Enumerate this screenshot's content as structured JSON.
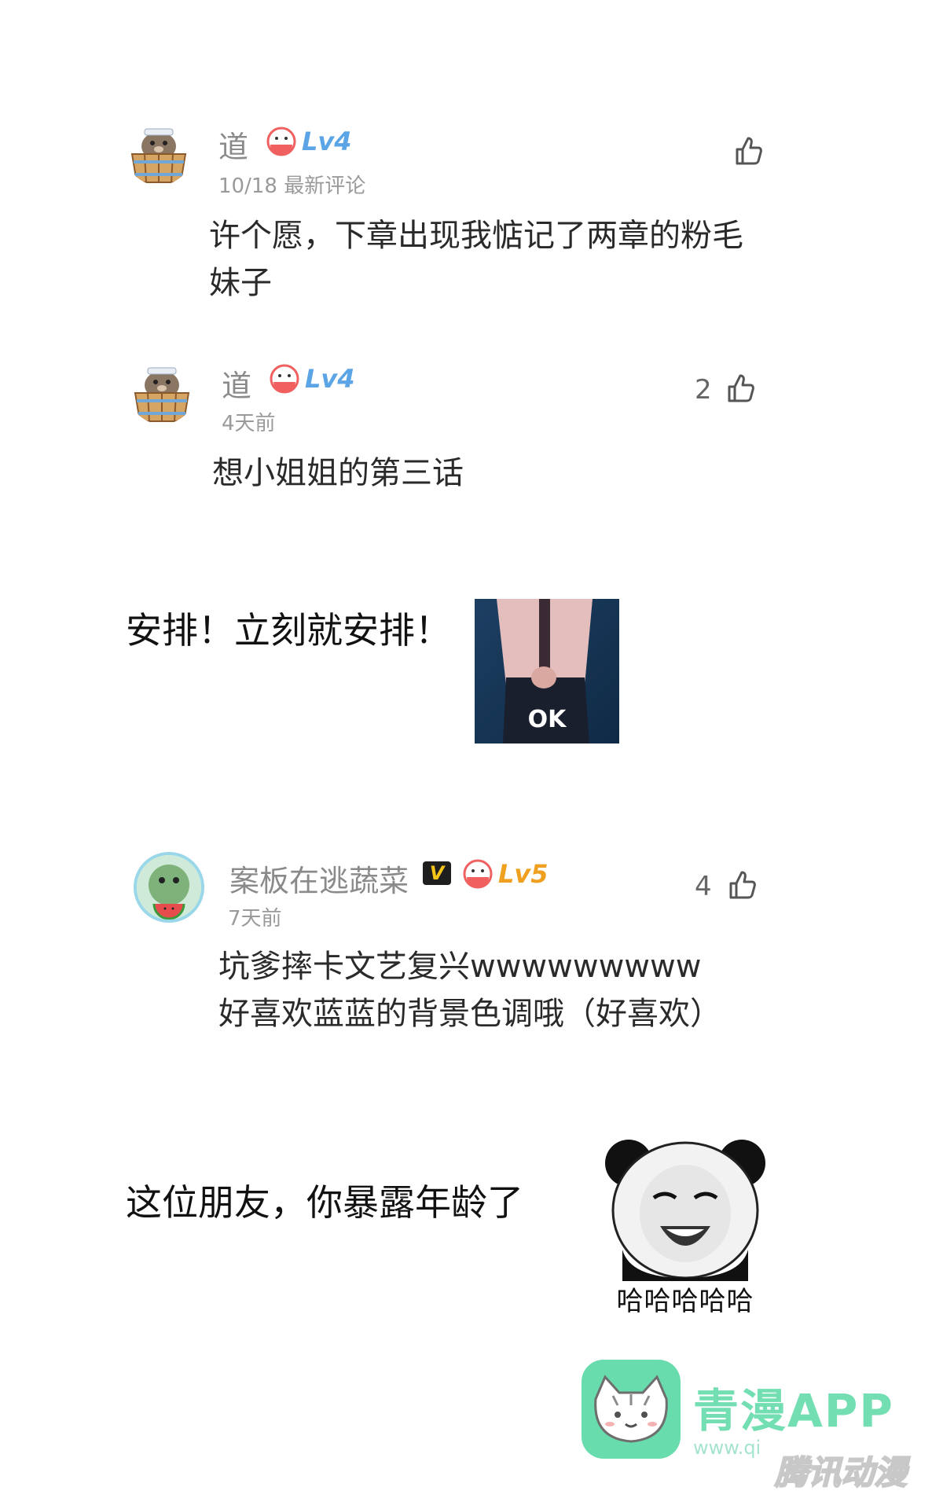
{
  "comments": [
    {
      "username": "道",
      "level": "Lv4",
      "meta": "10/18 最新评论",
      "likes": "",
      "lines": [
        "许个愿，下章出现我惦记了两章的粉毛",
        "妹子"
      ]
    },
    {
      "username": "道",
      "level": "Lv4",
      "meta": "4天前",
      "likes": "2",
      "lines": [
        "想小姐姐的第三话"
      ]
    },
    {
      "username": "案板在逃蔬菜",
      "vip": "V",
      "level": "Lv5",
      "meta": "7天前",
      "likes": "4",
      "lines": [
        "坑爹摔卡文艺复兴wwwwwwwww",
        "好喜欢蓝蓝的背景色调哦（好喜欢）"
      ]
    }
  ],
  "replies": [
    {
      "text": "安排！立刻就安排！",
      "sticker_label": "OK"
    },
    {
      "text": "这位朋友，你暴露年龄了",
      "sticker_label": "哈哈哈哈哈"
    }
  ],
  "watermark": {
    "brand": "青漫APP",
    "url": "www.qi",
    "corner_mark": "腾讯动漫"
  },
  "colors": {
    "level4": "#5ba4e6",
    "level5": "#f0a020",
    "vip_badge": "#f5c518",
    "like_icon": "#555555",
    "watermark_green": "#4fd6a0"
  },
  "icons": [
    "sealion-bathtub-avatar",
    "frog-watermelon-avatar",
    "thumbs-up-icon",
    "level-face-icon",
    "vip-badge-icon",
    "panda-meme-sticker",
    "cat-logo-icon"
  ]
}
